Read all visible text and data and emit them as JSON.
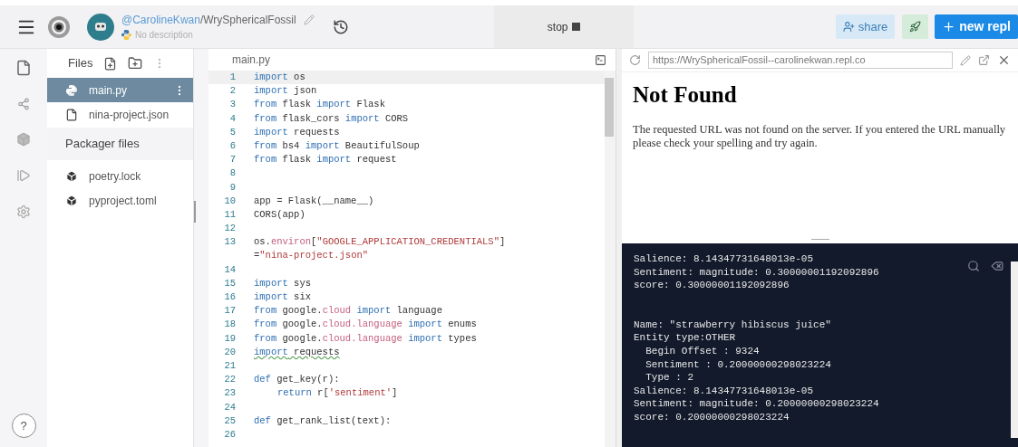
{
  "header": {
    "owner": "@CarolineKwan",
    "repl_name": "/WrySphericalFossil",
    "description": "No description",
    "stop_button": "stop",
    "share_button": "share",
    "new_repl_button": "new repl"
  },
  "rail": {
    "help": "?"
  },
  "files": {
    "title": "Files",
    "items": [
      {
        "name": "main.py",
        "kind": "python",
        "selected": true
      },
      {
        "name": "nina-project.json",
        "kind": "file",
        "selected": false
      }
    ],
    "packager_title": "Packager files",
    "packager_items": [
      {
        "name": "poetry.lock",
        "kind": "package",
        "selected": false
      },
      {
        "name": "pyproject.toml",
        "kind": "package",
        "selected": false
      }
    ]
  },
  "editor": {
    "tab": "main.py",
    "lines": [
      {
        "num": "1",
        "current": true,
        "warning": false,
        "tokens": [
          {
            "text": "import",
            "kind": "kw"
          },
          {
            "text": " os",
            "kind": "plain"
          }
        ]
      },
      {
        "num": "2",
        "current": false,
        "warning": false,
        "tokens": [
          {
            "text": "import",
            "kind": "kw"
          },
          {
            "text": " json",
            "kind": "plain"
          }
        ]
      },
      {
        "num": "3",
        "current": false,
        "warning": false,
        "tokens": [
          {
            "text": "from",
            "kind": "kw"
          },
          {
            "text": " flask ",
            "kind": "plain"
          },
          {
            "text": "import",
            "kind": "kw"
          },
          {
            "text": " Flask",
            "kind": "plain"
          }
        ]
      },
      {
        "num": "4",
        "current": false,
        "warning": false,
        "tokens": [
          {
            "text": "from",
            "kind": "kw"
          },
          {
            "text": " flask_cors ",
            "kind": "plain"
          },
          {
            "text": "import",
            "kind": "kw"
          },
          {
            "text": " CORS",
            "kind": "plain"
          }
        ]
      },
      {
        "num": "5",
        "current": false,
        "warning": false,
        "tokens": [
          {
            "text": "import",
            "kind": "kw"
          },
          {
            "text": " requests",
            "kind": "plain"
          }
        ]
      },
      {
        "num": "6",
        "current": false,
        "warning": false,
        "tokens": [
          {
            "text": "from",
            "kind": "kw"
          },
          {
            "text": " bs4 ",
            "kind": "plain"
          },
          {
            "text": "import",
            "kind": "kw"
          },
          {
            "text": " BeautifulSoup",
            "kind": "plain"
          }
        ]
      },
      {
        "num": "7",
        "current": false,
        "warning": false,
        "tokens": [
          {
            "text": "from",
            "kind": "kw"
          },
          {
            "text": " flask ",
            "kind": "plain"
          },
          {
            "text": "import",
            "kind": "kw"
          },
          {
            "text": " request",
            "kind": "plain"
          }
        ]
      },
      {
        "num": "8",
        "current": false
      },
      {
        "num": "9",
        "current": false
      },
      {
        "num": "10",
        "current": false,
        "warning": false,
        "tokens": [
          {
            "text": "app = Flask(__name__)",
            "kind": "plain"
          }
        ]
      },
      {
        "num": "11",
        "current": false,
        "warning": false,
        "tokens": [
          {
            "text": "CORS(app)",
            "kind": "plain"
          }
        ]
      },
      {
        "num": "12",
        "current": false
      },
      {
        "num": "13",
        "current": false,
        "warning": false,
        "tokens": [
          {
            "text": "os.",
            "kind": "plain"
          },
          {
            "text": "environ",
            "kind": "attr"
          },
          {
            "text": "[",
            "kind": "plain"
          },
          {
            "text": "\"GOOGLE_APPLICATION_CREDENTIALS\"",
            "kind": "str"
          },
          {
            "text": "]",
            "kind": "plain"
          }
        ]
      },
      {
        "current": false,
        "warning": false,
        "tokens": [
          {
            "text": "=",
            "kind": "plain"
          },
          {
            "text": "\"nina-project.json\"",
            "kind": "str"
          }
        ]
      },
      {
        "num": "14",
        "current": false
      },
      {
        "num": "15",
        "current": false,
        "warning": false,
        "tokens": [
          {
            "text": "import",
            "kind": "kw"
          },
          {
            "text": " sys",
            "kind": "plain"
          }
        ]
      },
      {
        "num": "16",
        "current": false,
        "warning": false,
        "tokens": [
          {
            "text": "import",
            "kind": "kw"
          },
          {
            "text": " six",
            "kind": "plain"
          }
        ]
      },
      {
        "num": "17",
        "current": false,
        "warning": false,
        "tokens": [
          {
            "text": "from",
            "kind": "kw"
          },
          {
            "text": " google.",
            "kind": "plain"
          },
          {
            "text": "cloud",
            "kind": "attr"
          },
          {
            "text": " import",
            "kind": "kw"
          },
          {
            "text": " language",
            "kind": "plain"
          }
        ]
      },
      {
        "num": "18",
        "current": false,
        "warning": false,
        "tokens": [
          {
            "text": "from",
            "kind": "kw"
          },
          {
            "text": " google.",
            "kind": "plain"
          },
          {
            "text": "cloud.language",
            "kind": "attr"
          },
          {
            "text": " import",
            "kind": "kw"
          },
          {
            "text": " enums",
            "kind": "plain"
          }
        ]
      },
      {
        "num": "19",
        "current": false,
        "warning": false,
        "tokens": [
          {
            "text": "from",
            "kind": "kw"
          },
          {
            "text": " google.",
            "kind": "plain"
          },
          {
            "text": "cloud.language",
            "kind": "attr"
          },
          {
            "text": " import",
            "kind": "kw"
          },
          {
            "text": " types",
            "kind": "plain"
          }
        ]
      },
      {
        "num": "20",
        "current": false,
        "warning": true,
        "tokens": [
          {
            "text": "import",
            "kind": "kw"
          },
          {
            "text": " requests",
            "kind": "plain"
          }
        ]
      },
      {
        "num": "21",
        "current": false
      },
      {
        "num": "22",
        "current": false,
        "warning": false,
        "tokens": [
          {
            "text": "def",
            "kind": "kw"
          },
          {
            "text": " get_key(r):",
            "kind": "plain"
          }
        ]
      },
      {
        "num": "23",
        "current": false,
        "warning": false,
        "indent": true,
        "tokens": [
          {
            "text": "return",
            "kind": "kw"
          },
          {
            "text": " r[",
            "kind": "plain"
          },
          {
            "text": "'sentiment'",
            "kind": "str"
          },
          {
            "text": "]",
            "kind": "plain"
          }
        ]
      },
      {
        "num": "24",
        "current": false
      },
      {
        "num": "25",
        "current": false,
        "warning": false,
        "tokens": [
          {
            "text": "def",
            "kind": "kw"
          },
          {
            "text": " get_rank_list(text):",
            "kind": "plain"
          }
        ]
      },
      {
        "num": "26",
        "current": false
      }
    ]
  },
  "browser": {
    "url": "https://WrySphericalFossil--carolinekwan.repl.co",
    "heading": "Not Found",
    "message": "The requested URL was not found on the server. If you entered the URL manually please check your spelling and try again."
  },
  "console": {
    "blocks": [
      [
        "Salience: 8.14347731648013e-05",
        "Sentiment: magnitude: 0.30000001192092896",
        "score: 0.30000001192092896"
      ],
      [
        "Name: \"strawberry hibiscus juice\"",
        "Entity type:OTHER",
        "  Begin Offset : 9324",
        "  Sentiment : 0.20000000298023224",
        "  Type : 2",
        "Salience: 8.14347731648013e-05",
        "Sentiment: magnitude: 0.20000000298023224",
        "score: 0.20000000298023224"
      ]
    ]
  }
}
